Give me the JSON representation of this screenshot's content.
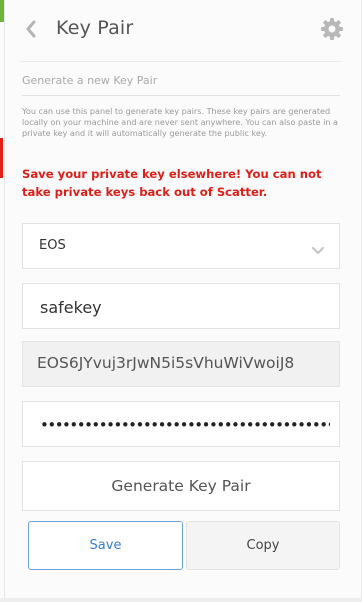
{
  "header": {
    "title": "Key Pair",
    "back_icon": "chevron-left-icon",
    "settings_icon": "gear-icon"
  },
  "section": {
    "title": "Generate a new Key Pair",
    "description": "You can use this panel to generate key pairs. These key pairs are generated locally on your machine and are never sent anywhere. You can also paste in a private key and it will automatically generate the public key.",
    "warning": "Save your private key elsewhere! You can not take private keys back out of Scatter."
  },
  "form": {
    "network_selected": "EOS",
    "key_name_value": "safekey",
    "public_key": "EOS6JYvuj3rJwN5i5sVhuWiVwoiJ8",
    "private_key_masked": "••••••••••••••••••••••••••••••••••••••••••••••••••••••••"
  },
  "buttons": {
    "generate_label": "Generate Key Pair",
    "save_label": "Save",
    "copy_label": "Copy"
  },
  "colors": {
    "warning": "#dd1f19",
    "save_accent": "#3a7fd5",
    "muted_text": "#9a9a9a"
  }
}
